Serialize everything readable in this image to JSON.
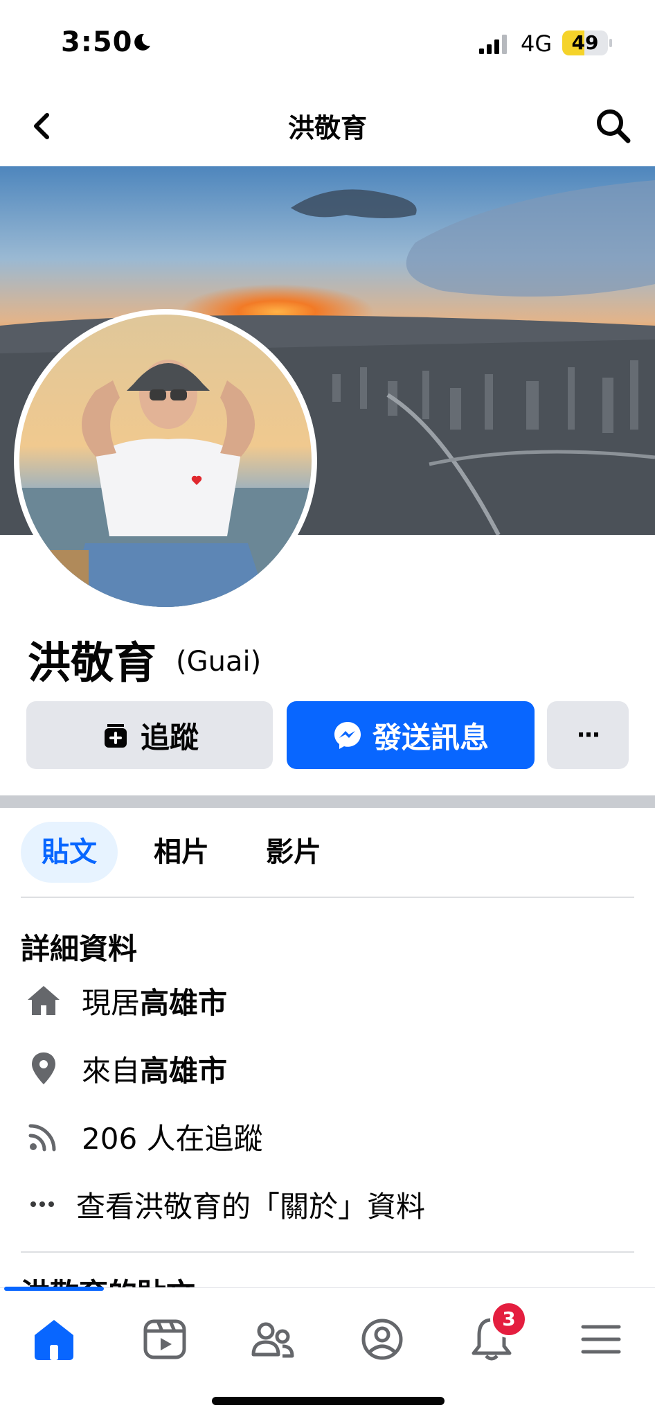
{
  "status_bar": {
    "time": "3:50",
    "network": "4G",
    "battery": "49",
    "battery_level": 0.49
  },
  "header": {
    "title": "洪敬育",
    "back_icon": "chevron-left-icon",
    "search_icon": "search-icon"
  },
  "profile": {
    "name": "洪敬育",
    "alt_name": "(Guai)"
  },
  "actions": {
    "follow_label": "追蹤",
    "message_label": "發送訊息",
    "more_label": "···"
  },
  "tabs": [
    {
      "label": "貼文",
      "active": true
    },
    {
      "label": "相片"
    },
    {
      "label": "影片"
    }
  ],
  "details": {
    "title": "詳細資料",
    "lives_prefix": "現居",
    "lives_city": "高雄市",
    "from_prefix": "來自",
    "from_city": "高雄市",
    "followers": "206 人在追蹤",
    "about": "查看洪敬育的「關於」資料"
  },
  "posts_heading": "洪敬育的貼文",
  "bottom_nav": {
    "items": [
      "home-icon",
      "video-icon",
      "friends-icon",
      "profile-icon",
      "notifications-icon",
      "menu-icon"
    ],
    "notification_count": "3"
  },
  "colors": {
    "accent": "#0866ff",
    "badge": "#e41e3f",
    "tab_active_bg": "#e7f3ff"
  }
}
